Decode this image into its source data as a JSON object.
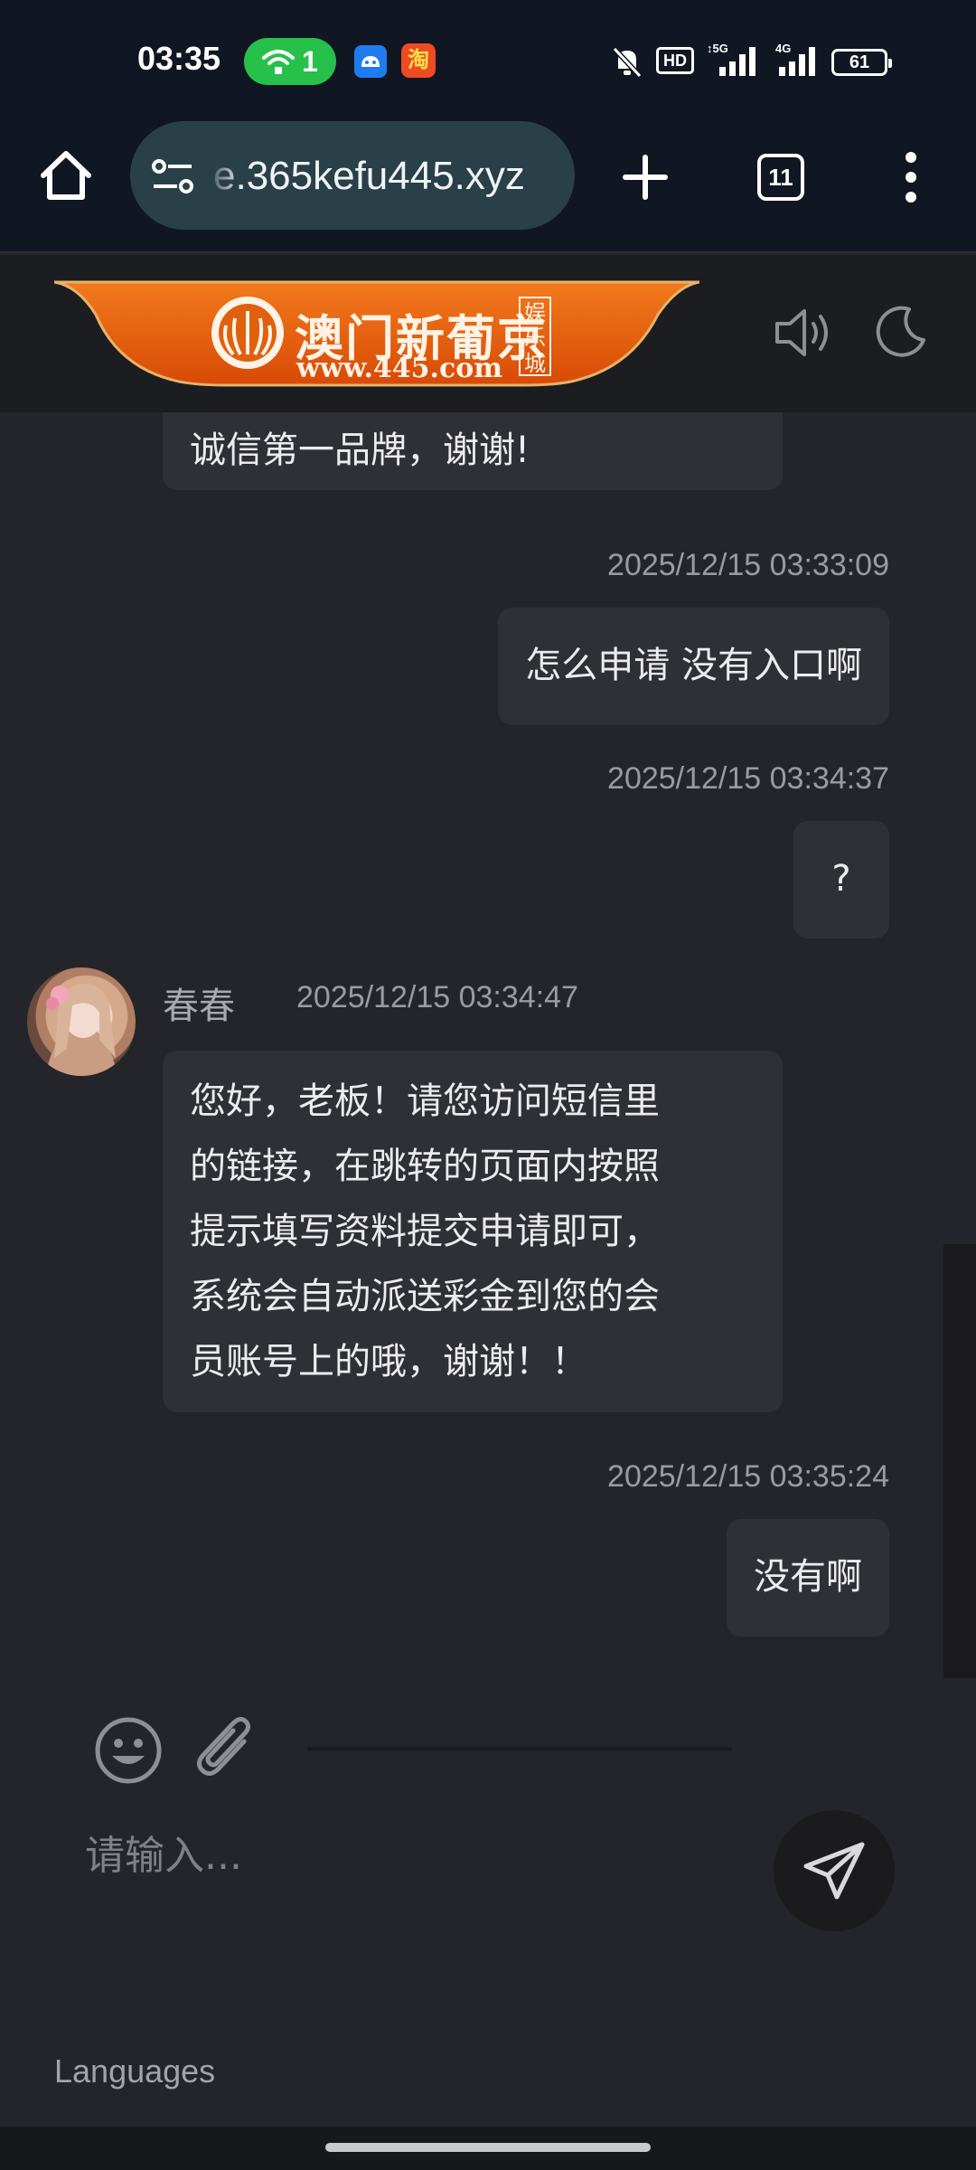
{
  "status_bar": {
    "time": "03:35",
    "hotspot_count": "1",
    "hd_label": "HD",
    "battery": "61",
    "app2_glyph": "淘"
  },
  "browser": {
    "url": "e.365kefu445.xyz",
    "tab_count": "11"
  },
  "site": {
    "logo_name": "澳门新葡京",
    "logo_domain": "www.445.com",
    "logo_badge": "娱乐城",
    "brand_color": "#e85d10"
  },
  "chat": {
    "messages": [
      {
        "side": "agent",
        "text": "诚信第一品牌，谢谢!"
      },
      {
        "side": "user",
        "time": "2025/12/15 03:33:09",
        "text": "怎么申请 没有入口啊"
      },
      {
        "side": "user",
        "time": "2025/12/15 03:34:37",
        "text": "?"
      },
      {
        "side": "agent",
        "name": "春春",
        "time": "2025/12/15 03:34:47",
        "lines": [
          "您好，老板！请您访问短信里",
          "的链接，在跳转的页面内按照",
          "提示填写资料提交申请即可，",
          "系统会自动派送彩金到您的会",
          "员账号上的哦，谢谢！！"
        ]
      },
      {
        "side": "user",
        "time": "2025/12/15 03:35:24",
        "text": "没有啊"
      }
    ]
  },
  "composer": {
    "placeholder": "请输入...",
    "languages_label": "Languages"
  },
  "icons": {
    "home": "home-icon",
    "site_settings": "tune-icon",
    "new_tab": "plus-icon",
    "tabs": "tab-switcher-icon",
    "menu": "more-vert-icon",
    "sound": "volume-icon",
    "theme": "moon-icon",
    "emoji": "emoji-icon",
    "attach": "paperclip-icon",
    "send": "send-icon"
  }
}
